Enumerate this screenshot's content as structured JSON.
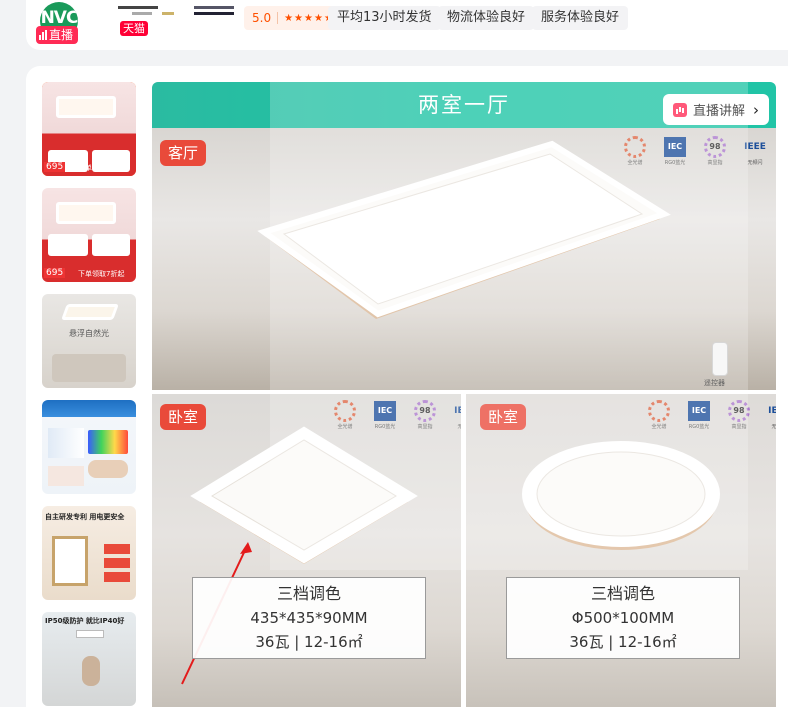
{
  "store": {
    "logo_text": "NVC",
    "live_label": "直播",
    "tmall_label": "天猫",
    "rating": "5.0",
    "stars": "★★★★★",
    "services": [
      "平均13小时发货",
      "物流体验良好",
      "服务体验良好"
    ]
  },
  "thumbnails": [
    {
      "name": "thumb-1",
      "price": "695",
      "promo": "下单领取7折起",
      "active": true
    },
    {
      "name": "thumb-2",
      "price": "695",
      "promo": "下单领取7折起",
      "active": false
    },
    {
      "name": "thumb-3",
      "caption": "悬浮自然光",
      "active": false
    },
    {
      "name": "thumb-4",
      "active": false
    },
    {
      "name": "thumb-5",
      "caption": "自主研发专利 用电更安全",
      "active": false
    },
    {
      "name": "thumb-6",
      "caption": "IP50级防护 就比IP40好",
      "active": false
    }
  ],
  "main_image": {
    "banner_title": "两室一厅",
    "live_explain": "直播讲解",
    "living_room_tag": "客厅",
    "bedroom_left_tag": "卧室",
    "bedroom_right_tag": "卧室",
    "remote_caption": "遥控器",
    "certs": [
      {
        "label": "全光谱",
        "sub": "LED灯珠"
      },
      {
        "label": "RG0蓝光",
        "sub": "IEC"
      },
      {
        "label": "高显指",
        "sub": "98"
      },
      {
        "label": "无频闪",
        "sub": "IEEE"
      }
    ],
    "spec_left": {
      "line1": "三档调色",
      "line2": "435*435*90MM",
      "line3": "36瓦 | 12-16㎡"
    },
    "spec_right": {
      "line1": "三档调色",
      "line2": "Φ500*100MM",
      "line3": "36瓦 | 12-16㎡"
    }
  }
}
